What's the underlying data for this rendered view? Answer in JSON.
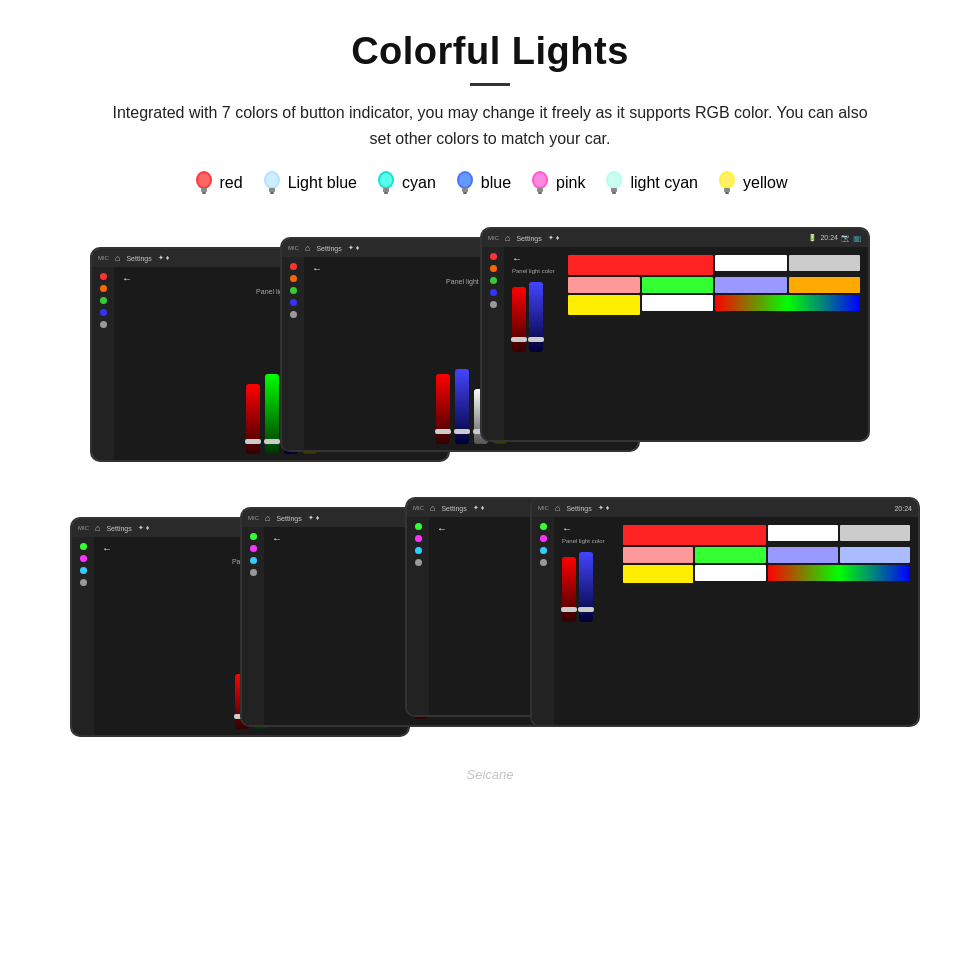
{
  "header": {
    "title": "Colorful Lights",
    "subtitle": "Integrated with 7 colors of button indicator, you may change it freely as it supports RGB color. You can also set other colors to match your car."
  },
  "colors": [
    {
      "name": "red",
      "hex": "#ff2222",
      "glowColor": "#ff4444"
    },
    {
      "name": "Light blue",
      "hex": "#aaddff",
      "glowColor": "#aaddff"
    },
    {
      "name": "cyan",
      "hex": "#00ffee",
      "glowColor": "#00ffee"
    },
    {
      "name": "blue",
      "hex": "#4488ff",
      "glowColor": "#4488ff"
    },
    {
      "name": "pink",
      "hex": "#ff44cc",
      "glowColor": "#ff44cc"
    },
    {
      "name": "light cyan",
      "hex": "#aaffee",
      "glowColor": "#aaffee"
    },
    {
      "name": "yellow",
      "hex": "#ffee22",
      "glowColor": "#ffee22"
    }
  ],
  "screens": {
    "panel_label": "Panel light color",
    "settings_label": "Settings",
    "back_label": "←"
  },
  "watermark": "Seicane"
}
